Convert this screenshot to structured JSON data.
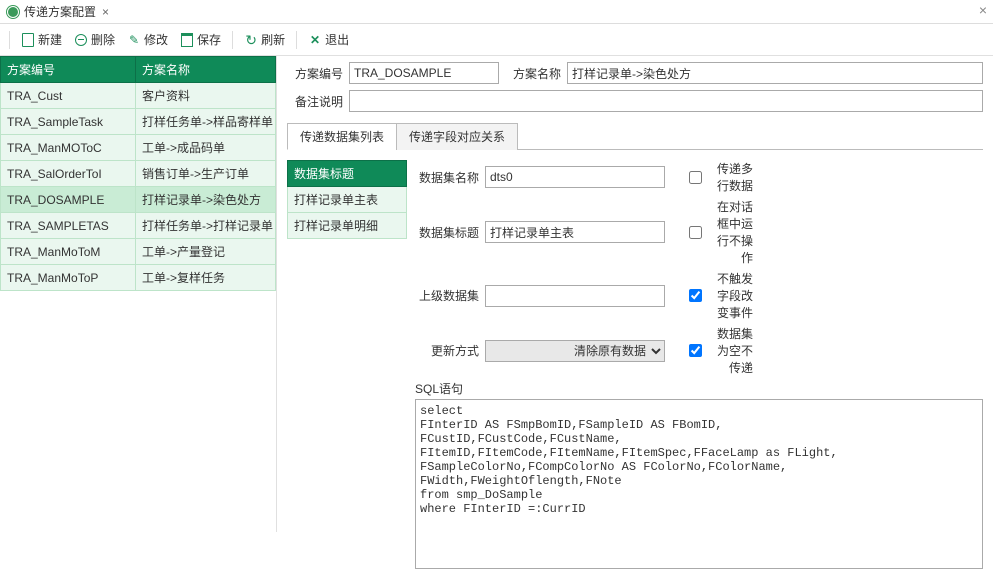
{
  "window": {
    "title": "传递方案配置"
  },
  "toolbar": {
    "new": "新建",
    "del": "删除",
    "edit": "修改",
    "save": "保存",
    "refresh": "刷新",
    "exit": "退出"
  },
  "leftgrid": {
    "col1": "方案编号",
    "col2": "方案名称",
    "rows": [
      {
        "id": "TRA_Cust",
        "name": "客户资料"
      },
      {
        "id": "TRA_SampleTask",
        "name": "打样任务单->样品寄样单"
      },
      {
        "id": "TRA_ManMOToC",
        "name": "工单->成品码单"
      },
      {
        "id": "TRA_SalOrderToI",
        "name": "销售订单->生产订单"
      },
      {
        "id": "TRA_DOSAMPLE",
        "name": "打样记录单->染色处方"
      },
      {
        "id": "TRA_SAMPLETAS",
        "name": "打样任务单->打样记录单"
      },
      {
        "id": "TRA_ManMoToM",
        "name": "工单->产量登记"
      },
      {
        "id": "TRA_ManMoToP",
        "name": "工单->复样任务"
      }
    ],
    "selected": 4
  },
  "form": {
    "code_label": "方案编号",
    "code_value": "TRA_DOSAMPLE",
    "name_label": "方案名称",
    "name_value": "打样记录单->染色处方",
    "remark_label": "备注说明",
    "remark_value": ""
  },
  "tabs": {
    "t1": "传递数据集列表",
    "t2": "传递字段对应关系",
    "active": 0
  },
  "dslist": {
    "header": "数据集标题",
    "items": [
      "打样记录单主表",
      "打样记录单明细"
    ],
    "selected": 0
  },
  "dsdetail": {
    "name_label": "数据集名称",
    "name_value": "dts0",
    "title_label": "数据集标题",
    "title_value": "打样记录单主表",
    "parent_label": "上级数据集",
    "parent_value": "",
    "update_label": "更新方式",
    "update_value": "清除原有数据",
    "sql_label": "SQL语句",
    "sql_value": "select\nFInterID AS FSmpBomID,FSampleID AS FBomID,\nFCustID,FCustCode,FCustName,\nFItemID,FItemCode,FItemName,FItemSpec,FFaceLamp as FLight,\nFSampleColorNo,FCompColorNo AS FColorNo,FColorName,\nFWidth,FWeightOflength,FNote\nfrom smp_DoSample\nwhere FInterID =:CurrID",
    "chk_multi": "传递多行数据",
    "chk_multi_checked": false,
    "chk_dialog": "在对话框中运行不操作",
    "chk_dialog_checked": false,
    "chk_trigger": "不触发字段改变事件",
    "chk_trigger_checked": true,
    "chk_empty": "数据集为空不传递",
    "chk_empty_checked": true
  }
}
